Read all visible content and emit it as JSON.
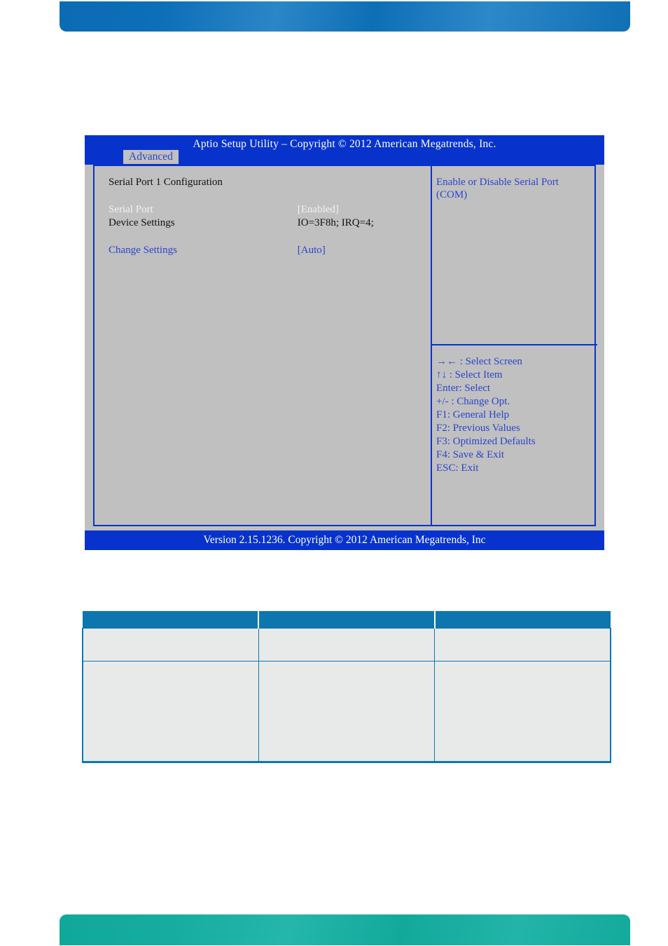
{
  "bios": {
    "title": "Aptio Setup Utility  –  Copyright © 2012 American Megatrends, Inc.",
    "tab": "Advanced",
    "section_title": "Serial Port 1 Configuration",
    "options": [
      {
        "label": "Serial Port",
        "value": "[Enabled]",
        "state": "highlighted"
      },
      {
        "label": "Device Settings",
        "value": "IO=3F8h; IRQ=4;",
        "state": "plain"
      },
      {
        "label": "Change Settings",
        "value": "[Auto]",
        "state": "link"
      }
    ],
    "help_text": "Enable or Disable Serial Port (COM)",
    "nav_keys": [
      "→← : Select Screen",
      "↑↓ : Select Item",
      "Enter: Select",
      "+/- : Change Opt.",
      "F1: General Help",
      "F2: Previous Values",
      "F3: Optimized Defaults",
      "F4: Save & Exit",
      "ESC: Exit"
    ],
    "footer": "Version 2.15.1236. Copyright © 2012 American Megatrends, Inc"
  },
  "table": {
    "headers": [
      "",
      "",
      ""
    ],
    "rows": [
      [
        "",
        "",
        ""
      ],
      [
        "",
        "",
        ""
      ]
    ]
  },
  "colors": {
    "bios_blue": "#0733cc",
    "bios_gray": "#c0c0c0",
    "bios_text_link": "#2b44cc",
    "table_header": "#0e76af",
    "table_cell": "#e8eaea",
    "banner_top": "#0d6fb8",
    "banner_bottom": "#16ada0"
  }
}
